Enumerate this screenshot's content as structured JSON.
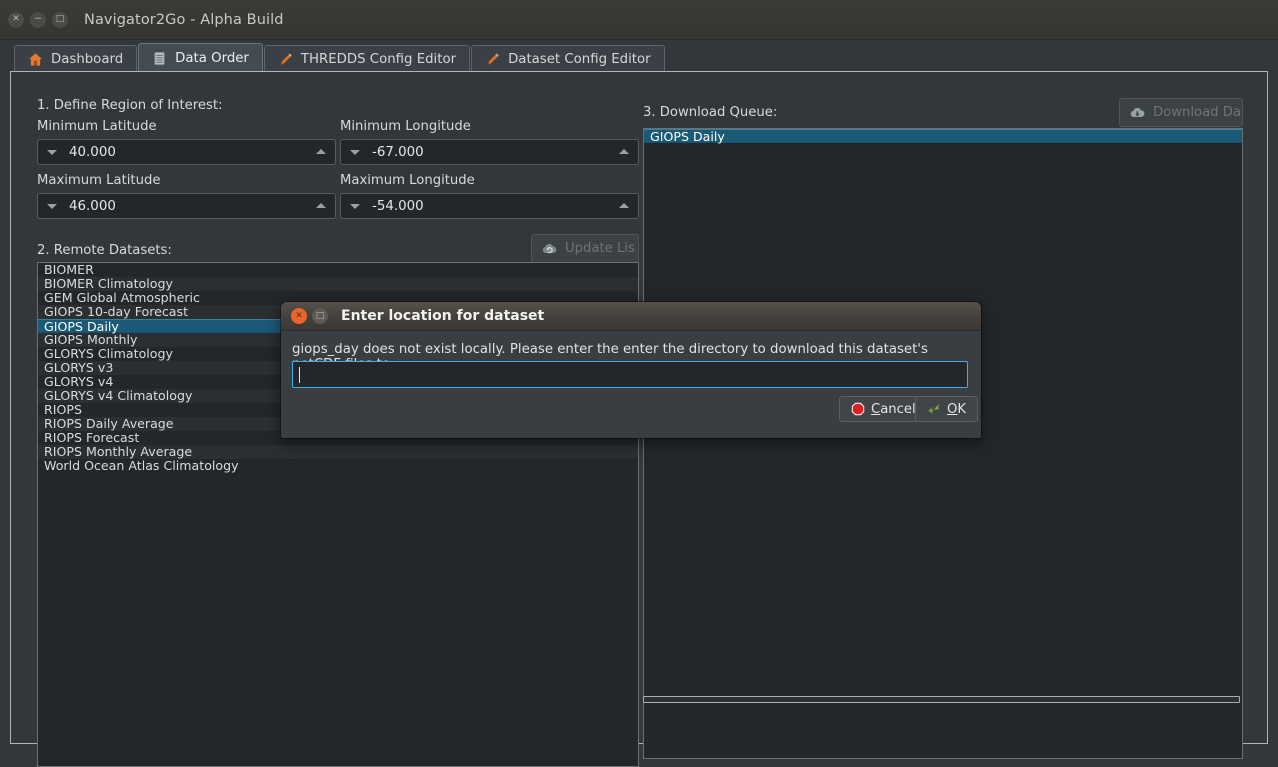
{
  "window": {
    "title": "Navigator2Go - Alpha Build",
    "controls": [
      {
        "name": "close",
        "glyph": "✕"
      },
      {
        "name": "minimize",
        "glyph": "−"
      },
      {
        "name": "maximize",
        "glyph": "□"
      }
    ]
  },
  "tabs": [
    {
      "label": "Dashboard",
      "icon": "home-icon",
      "active": false
    },
    {
      "label": "Data Order",
      "icon": "server-icon",
      "active": true
    },
    {
      "label": "THREDDS Config Editor",
      "icon": "pencil-icon",
      "active": false
    },
    {
      "label": "Dataset Config Editor",
      "icon": "pencil-icon",
      "active": false
    }
  ],
  "region": {
    "heading": "1. Define Region of Interest:",
    "fields": [
      {
        "label": "Minimum Latitude",
        "value": "40.000"
      },
      {
        "label": "Minimum Longitude",
        "value": "-67.000"
      },
      {
        "label": "Maximum Latitude",
        "value": "46.000"
      },
      {
        "label": "Maximum Longitude",
        "value": "-54.000"
      }
    ]
  },
  "remote": {
    "heading": "2. Remote Datasets:",
    "update_button": {
      "label": "Update Lis",
      "icon": "cloud-refresh-icon",
      "disabled": true
    },
    "items": [
      "BIOMER",
      "BIOMER Climatology",
      "GEM Global Atmospheric",
      "GIOPS 10-day Forecast",
      "GIOPS Daily",
      "GIOPS Monthly",
      "GLORYS Climatology",
      "GLORYS v3",
      "GLORYS v4",
      "GLORYS v4 Climatology",
      "RIOPS",
      "RIOPS Daily Average",
      "RIOPS Forecast",
      "RIOPS Monthly Average",
      "World Ocean Atlas Climatology"
    ],
    "selected": "GIOPS Daily"
  },
  "queue": {
    "heading": "3. Download Queue:",
    "download_button": {
      "label": "Download Data",
      "icon": "cloud-download-icon",
      "disabled": true
    },
    "items": [
      "GIOPS Daily"
    ],
    "selected": "GIOPS Daily"
  },
  "dialog": {
    "title": "Enter location for dataset",
    "message": "giops_day  does not exist locally. Please enter the enter the directory to download this dataset's netCDF files to.",
    "input_value": "",
    "input_placeholder": "",
    "cancel": {
      "label_pre": "",
      "accel": "C",
      "label_post": "ancel",
      "icon": "stop-icon"
    },
    "ok": {
      "label_pre": "",
      "accel": "O",
      "label_post": "K",
      "icon": "enter-arrow-icon"
    },
    "controls": [
      {
        "name": "close",
        "glyph": "✕"
      },
      {
        "name": "maximize",
        "glyph": "□"
      }
    ]
  },
  "colors": {
    "accent_orange": "#e8662b",
    "selection_blue": "#1b5a77",
    "focus_blue": "#3daee9",
    "window_bg": "#31373b",
    "field_bg": "#232729"
  }
}
